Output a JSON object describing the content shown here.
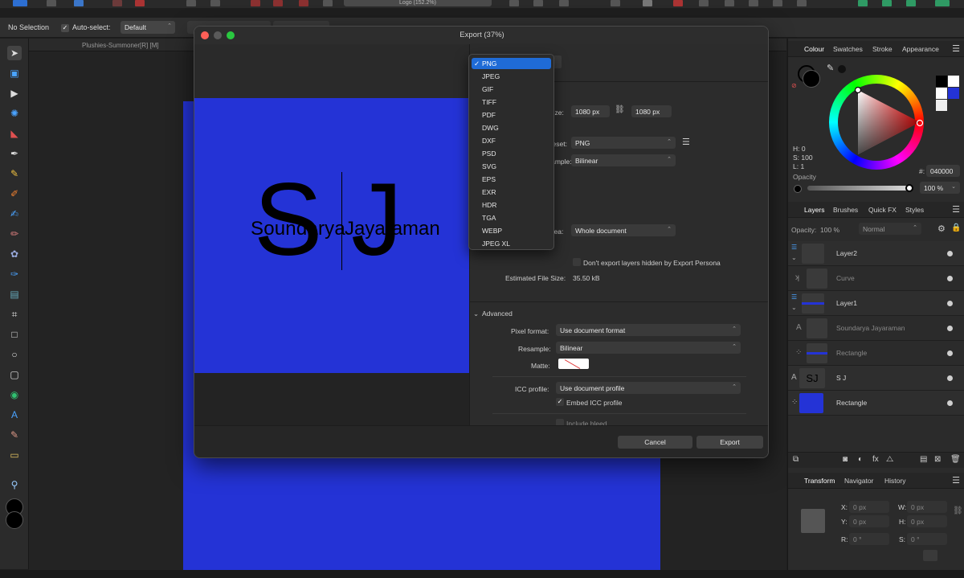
{
  "toolbar": {
    "no_selection": "No Selection",
    "auto_select_label": "Auto-select:",
    "auto_select_value": "Default",
    "title_pill": "Logo (152.2%)"
  },
  "document_tab": "Plushies-Summoner[R] [M]",
  "dialog": {
    "title": "Export (37%)",
    "size_label": "Size:",
    "width_value": "1080 px",
    "height_value": "1080 px",
    "preset_label": "Preset:",
    "preset_value": "PNG",
    "resample_label": "Resample:",
    "resample_value": "Bilinear",
    "area_label": "Area:",
    "area_value": "Whole document",
    "dont_export_hidden": "Don't export layers hidden by Export Persona",
    "est_file_size_label": "Estimated File Size:",
    "est_file_size_value": "35.50 kB",
    "advanced_label": "Advanced",
    "pixel_format_label": "Pixel format:",
    "pixel_format_value": "Use document format",
    "adv_resample_label": "Resample:",
    "adv_resample_value": "Bilinear",
    "matte_label": "Matte:",
    "icc_profile_label": "ICC profile:",
    "icc_profile_value": "Use document profile",
    "embed_icc": "Embed ICC profile",
    "include_bleed": "Include bleed",
    "cancel": "Cancel",
    "export": "Export"
  },
  "format_dropdown": {
    "selected": "PNG",
    "items": [
      "PNG",
      "JPEG",
      "GIF",
      "TIFF",
      "PDF",
      "DWG",
      "DXF",
      "PSD",
      "SVG",
      "EPS",
      "EXR",
      "HDR",
      "TGA",
      "WEBP",
      "JPEG XL"
    ]
  },
  "logo": {
    "initials_left": "S",
    "initials_right": "J",
    "name_left": "Soundarya",
    "name_right": "Jayaraman"
  },
  "colour_panel": {
    "tabs": [
      "Colour",
      "Swatches",
      "Stroke",
      "Appearance"
    ],
    "h": "H: 0",
    "s": "S: 100",
    "l": "L: 1",
    "opacity_label": "Opacity",
    "hex_label": "#:",
    "hex_value": "040000",
    "opacity_value": "100 %"
  },
  "layers_panel": {
    "tabs": [
      "Layers",
      "Brushes",
      "Quick FX",
      "Styles"
    ],
    "opacity_label": "Opacity:",
    "opacity_value": "100 %",
    "blend_mode": "Normal",
    "layers": [
      {
        "name": "Layer2"
      },
      {
        "name": "Curve"
      },
      {
        "name": "Layer1"
      },
      {
        "name": "Soundarya Jayaraman"
      },
      {
        "name": "Rectangle"
      },
      {
        "name": "S J"
      },
      {
        "name": "Rectangle"
      }
    ]
  },
  "transform_panel": {
    "tabs": [
      "Transform",
      "Navigator",
      "History"
    ],
    "x_label": "X:",
    "x_value": "0 px",
    "y_label": "Y:",
    "y_value": "0 px",
    "w_label": "W:",
    "w_value": "0 px",
    "h_label": "H:",
    "h_value": "0 px",
    "r_label": "R:",
    "r_value": "0 °",
    "s_label": "S:",
    "s_value": "0 °"
  },
  "colors": {
    "accent": "#1f6bd6",
    "canvas_blue": "#2433d6"
  }
}
